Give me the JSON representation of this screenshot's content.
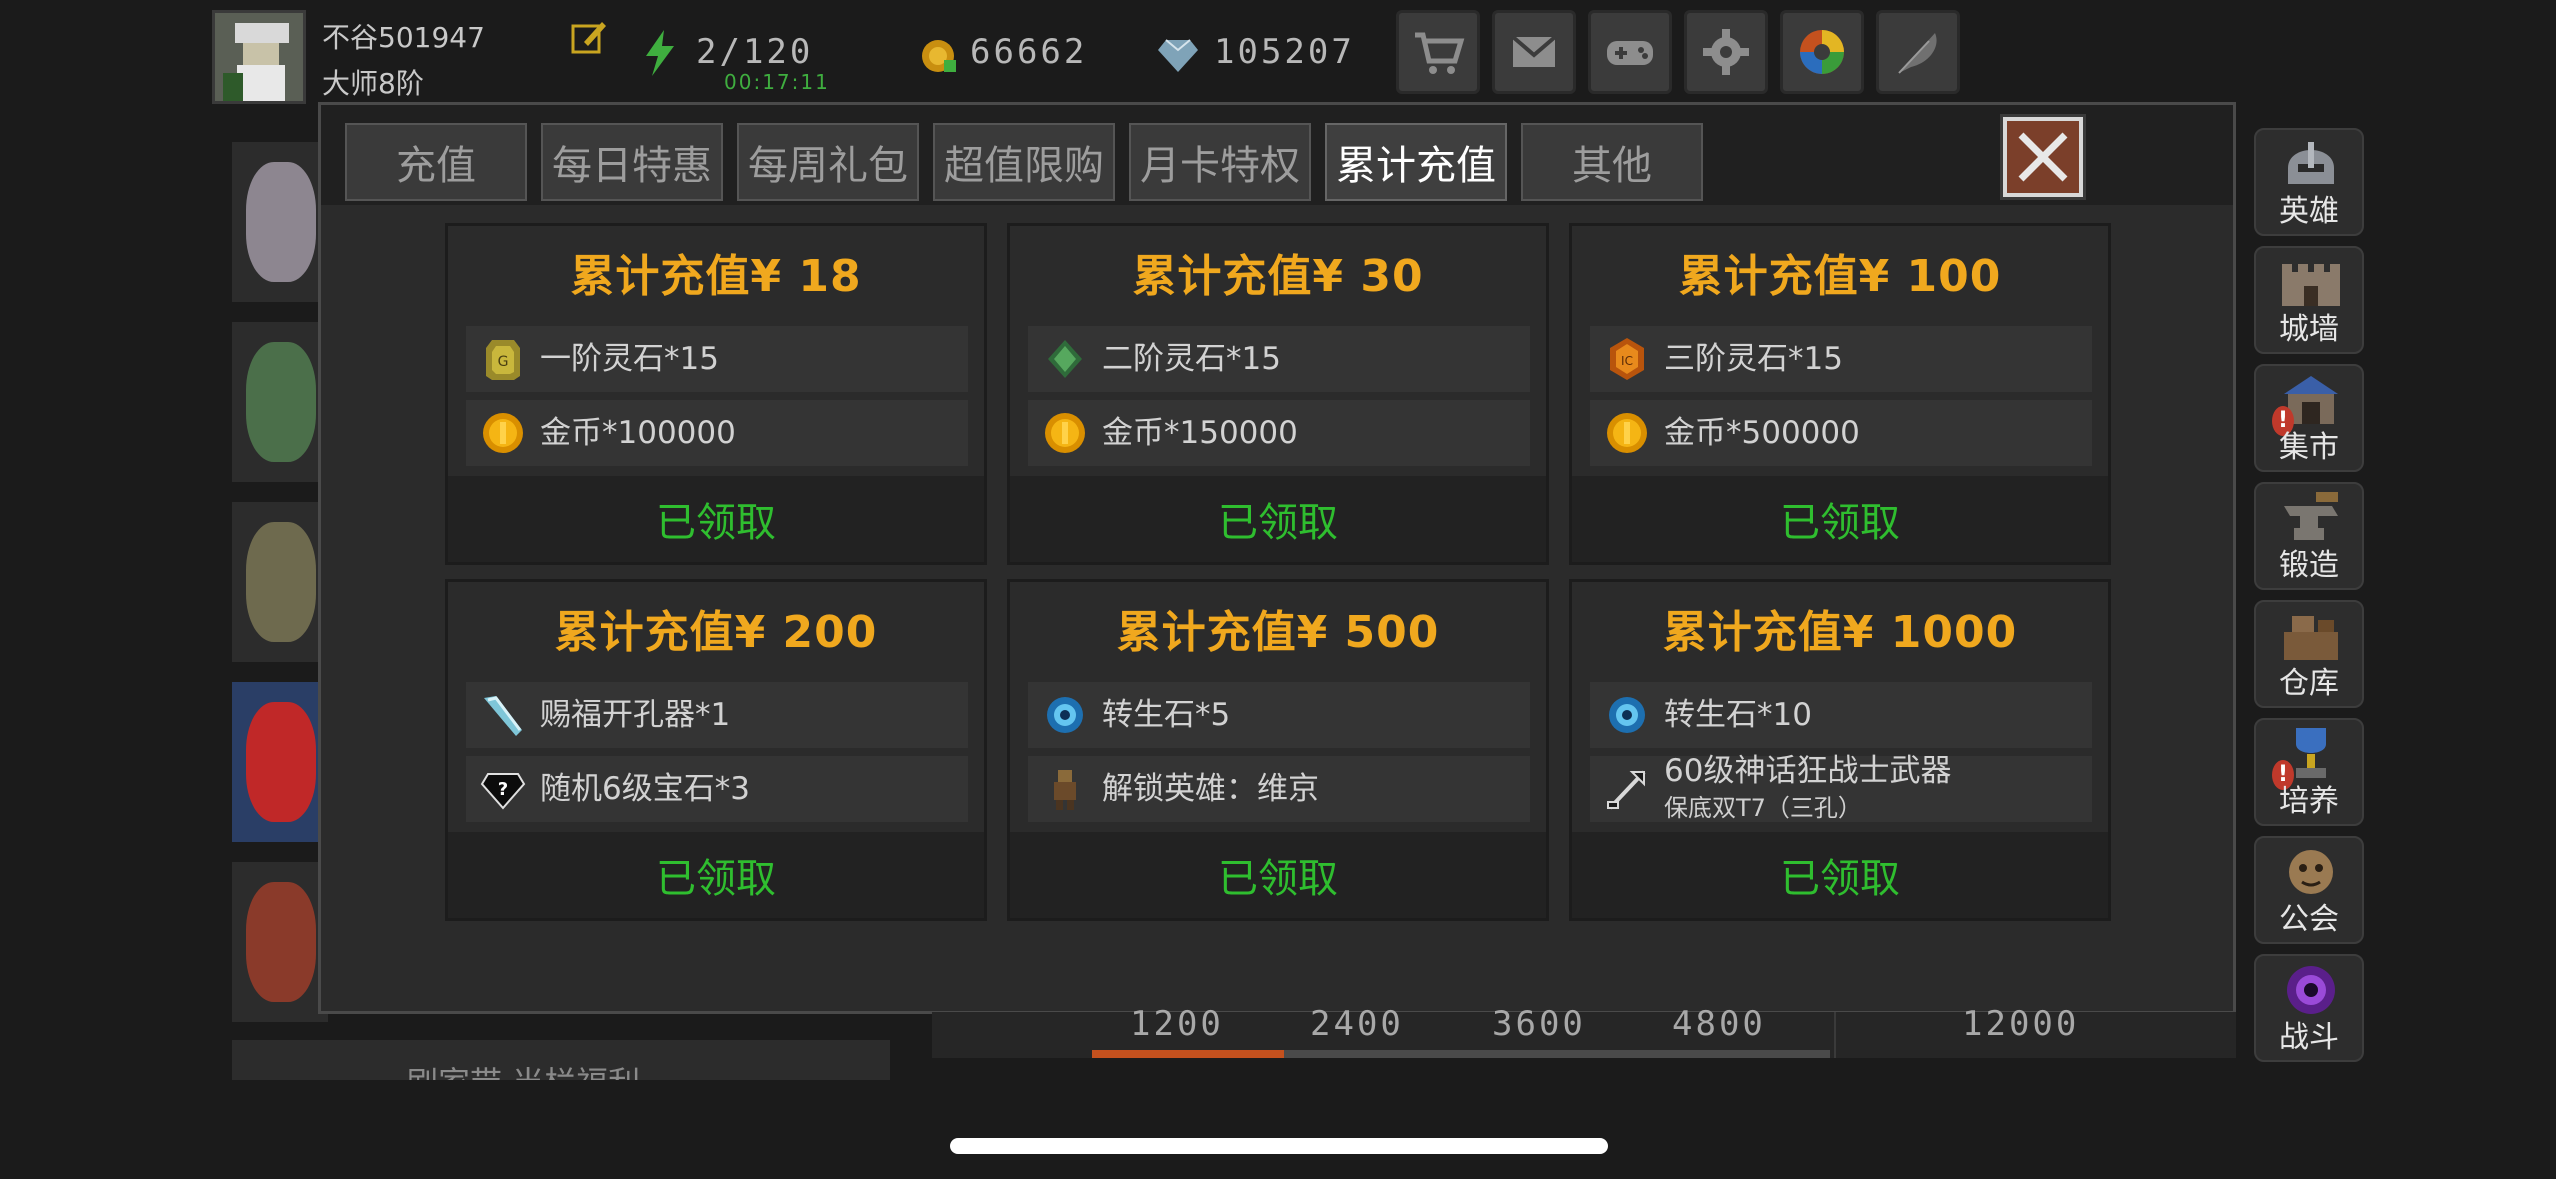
{
  "player": {
    "name": "不谷501947",
    "rank": "大师8阶",
    "stamina": "2/120",
    "gold": "66662",
    "gems": "105207",
    "timer": "00:17:11"
  },
  "top_icons": [
    "shop-cart-icon",
    "mail-icon",
    "gamepad-icon",
    "settings-gear-icon",
    "color-wheel-icon",
    "feather-icon"
  ],
  "tabs": [
    {
      "label": "充值"
    },
    {
      "label": "每日特惠"
    },
    {
      "label": "每周礼包"
    },
    {
      "label": "超值限购"
    },
    {
      "label": "月卡特权"
    },
    {
      "label": "累计充值"
    },
    {
      "label": "其他"
    }
  ],
  "active_tab": "累计充值",
  "cards": [
    {
      "title": "累计充值¥ 18",
      "rewards": [
        {
          "icon": "tier1-spirit-stone-icon",
          "text": "一阶灵石*15"
        },
        {
          "icon": "gold-coin-icon",
          "text": "金币*100000"
        }
      ],
      "status": "已领取"
    },
    {
      "title": "累计充值¥ 30",
      "rewards": [
        {
          "icon": "tier2-spirit-stone-icon",
          "text": "二阶灵石*15"
        },
        {
          "icon": "gold-coin-icon",
          "text": "金币*150000"
        }
      ],
      "status": "已领取"
    },
    {
      "title": "累计充值¥ 100",
      "rewards": [
        {
          "icon": "tier3-spirit-stone-icon",
          "text": "三阶灵石*15"
        },
        {
          "icon": "gold-coin-icon",
          "text": "金币*500000"
        }
      ],
      "status": "已领取"
    },
    {
      "title": "累计充值¥ 200",
      "rewards": [
        {
          "icon": "socket-drill-icon",
          "text": "赐福开孔器*1"
        },
        {
          "icon": "random-gem-icon",
          "text": "随机6级宝石*3"
        }
      ],
      "status": "已领取"
    },
    {
      "title": "累计充值¥ 500",
      "rewards": [
        {
          "icon": "rebirth-stone-icon",
          "text": "转生石*5"
        },
        {
          "icon": "hero-unlock-icon",
          "text": "解锁英雄：维京"
        }
      ],
      "status": "已领取"
    },
    {
      "title": "累计充值¥ 1000",
      "rewards": [
        {
          "icon": "rebirth-stone-icon",
          "text": "转生石*10"
        },
        {
          "icon": "myth-weapon-icon",
          "text": "60级神话狂战士武器",
          "sub": "保底双T7（三孔）"
        }
      ],
      "status": "已领取"
    }
  ],
  "sidebar": [
    {
      "label": "英雄",
      "icon": "hero-helmet-icon",
      "alert": false
    },
    {
      "label": "城墙",
      "icon": "city-wall-icon",
      "alert": false
    },
    {
      "label": "集市",
      "icon": "market-icon",
      "alert": true
    },
    {
      "label": "锻造",
      "icon": "anvil-icon",
      "alert": false
    },
    {
      "label": "仓库",
      "icon": "warehouse-icon",
      "alert": false
    },
    {
      "label": "培养",
      "icon": "trophy-icon",
      "alert": true
    },
    {
      "label": "公会",
      "icon": "guild-icon",
      "alert": false
    },
    {
      "label": "战斗",
      "icon": "portal-icon",
      "alert": false
    }
  ],
  "progress_marks": [
    "1200",
    "2400",
    "3600",
    "4800",
    "12000"
  ],
  "progress_fraction": 0.26,
  "bottom_left_text": "刷家带 当栏福利",
  "colors": {
    "title_gold": "#f0a81e",
    "claimed_green": "#2fbe2f",
    "close_red": "#7b3f2a"
  }
}
